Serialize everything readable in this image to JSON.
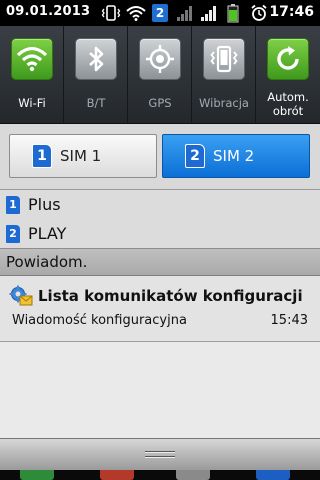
{
  "status_bar": {
    "date": "09.01.2013",
    "time": "17:46",
    "sim_badge": "2",
    "icons": [
      "vibrate-icon",
      "wifi-icon",
      "sim-2-badge-icon",
      "signal-icon",
      "signal-icon",
      "battery-icon",
      "alarm-icon"
    ]
  },
  "quick_settings": {
    "wifi": {
      "label": "Wi-Fi",
      "state": "on"
    },
    "bluetooth": {
      "label": "B/T",
      "state": "off"
    },
    "gps": {
      "label": "GPS",
      "state": "off"
    },
    "vibration": {
      "label": "Wibracja",
      "state": "off"
    },
    "autorotate": {
      "label": "Autom. obrót",
      "label_line1": "Autom.",
      "label_line2": "obrót",
      "state": "on"
    }
  },
  "sim_selector": {
    "sim1": {
      "label": "SIM 1",
      "number": "1"
    },
    "sim2": {
      "label": "SIM 2",
      "number": "2"
    },
    "active": "sim2"
  },
  "operators": [
    {
      "number": "1",
      "name": "Plus"
    },
    {
      "number": "2",
      "name": "PLAY"
    }
  ],
  "notifications_header": "Powiadom.",
  "notifications": [
    {
      "title": "Lista komunikatów konfiguracji",
      "subtitle": "Wiadomość konfiguracyjna",
      "time": "15:43"
    }
  ],
  "colors": {
    "toggle_on": "#5cb830",
    "sim_active": "#1a82e4",
    "sim_icon": "#1d6bd2"
  }
}
